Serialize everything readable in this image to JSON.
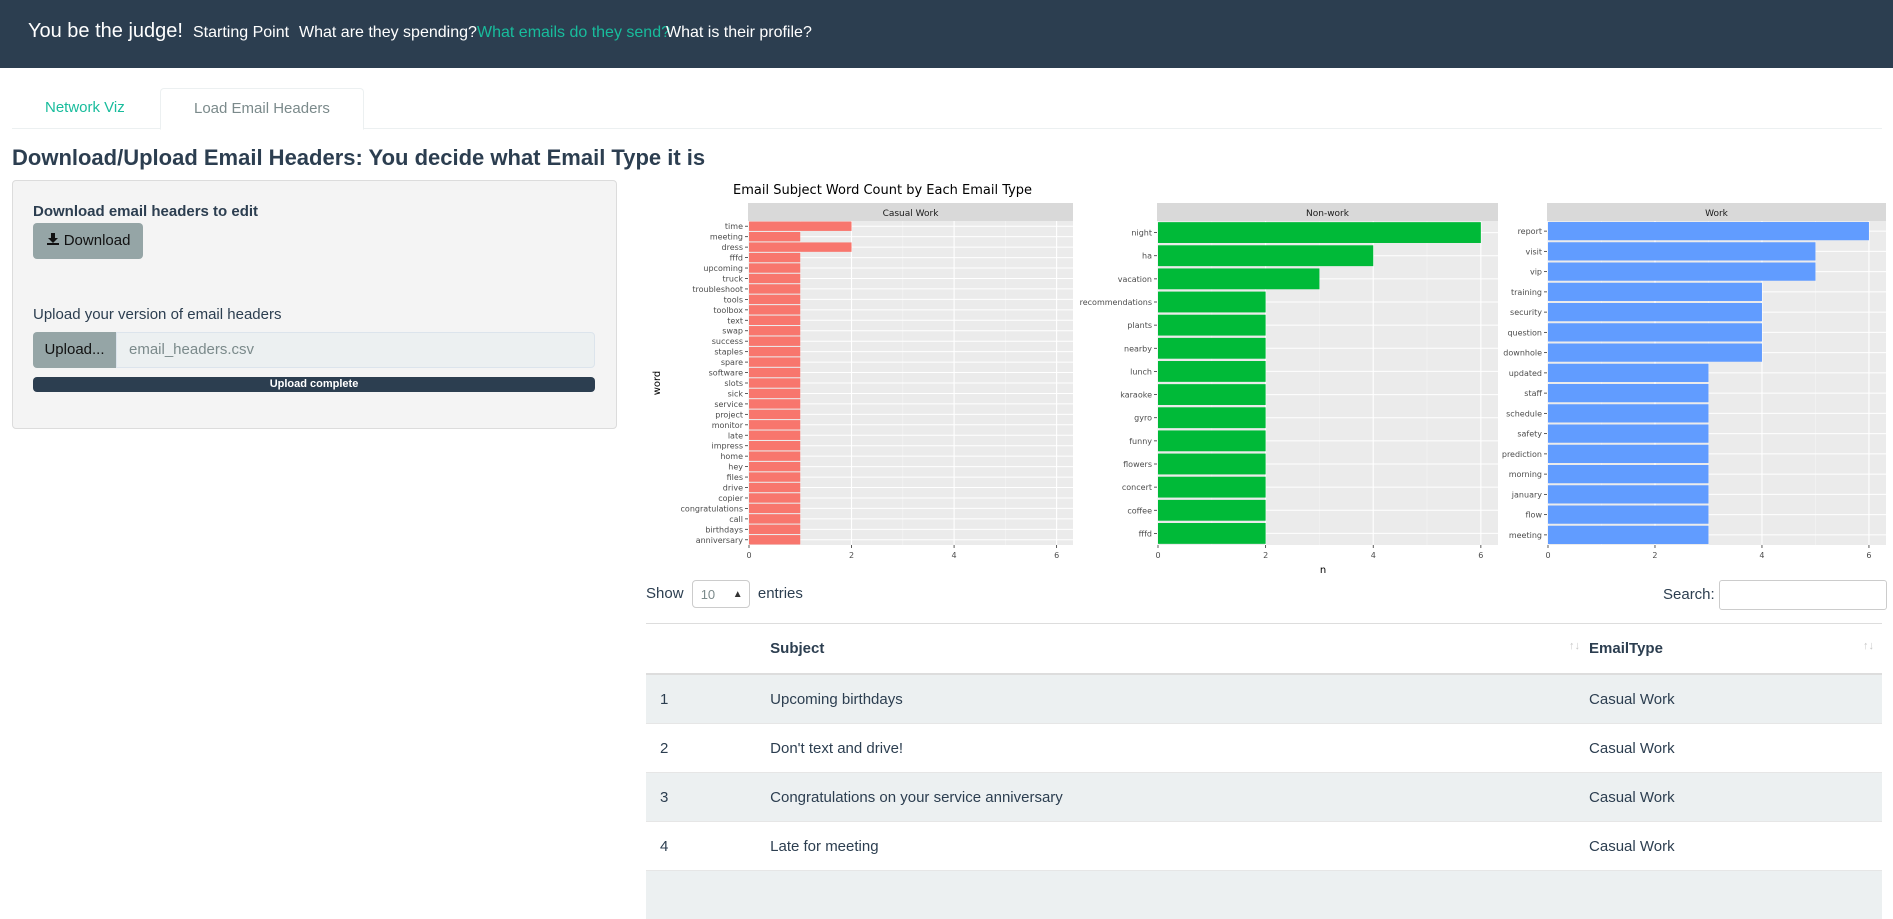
{
  "navbar": {
    "brand": "You be the judge!",
    "links": [
      "Starting Point",
      "What are they spending?",
      "What emails do they send?",
      "What is their profile?"
    ],
    "active_index": 2
  },
  "tabs": [
    "Network Viz",
    "Load Email Headers"
  ],
  "page_title": "Download/Upload Email Headers: You decide what Email Type it is",
  "sidebar": {
    "download_label": "Download email headers to edit",
    "download_button": "Download",
    "upload_label": "Upload your version of email headers",
    "upload_button": "Upload...",
    "file_name": "email_headers.csv",
    "progress_text": "Upload complete",
    "progress_fraction": 1.0
  },
  "chart_data": {
    "type": "bar",
    "orientation": "horizontal",
    "title": "Email Subject Word Count by Each Email Type",
    "xlabel": "n",
    "ylabel": "word",
    "xlim": [
      0,
      6.3
    ],
    "x_ticks": [
      0,
      2,
      4,
      6
    ],
    "facets": [
      {
        "name": "Casual Work",
        "color": "#f8766d",
        "categories": [
          "time",
          "meeting",
          "dress",
          "fffd",
          "upcoming",
          "truck",
          "troubleshoot",
          "tools",
          "toolbox",
          "text",
          "swap",
          "success",
          "staples",
          "spare",
          "software",
          "slots",
          "sick",
          "service",
          "project",
          "monitor",
          "late",
          "impress",
          "home",
          "hey",
          "files",
          "drive",
          "copier",
          "congratulations",
          "call",
          "birthdays",
          "anniversary"
        ],
        "values": [
          2,
          1,
          2,
          1,
          1,
          1,
          1,
          1,
          1,
          1,
          1,
          1,
          1,
          1,
          1,
          1,
          1,
          1,
          1,
          1,
          1,
          1,
          1,
          1,
          1,
          1,
          1,
          1,
          1,
          1,
          1
        ]
      },
      {
        "name": "Non-work",
        "color": "#00ba38",
        "categories": [
          "night",
          "ha",
          "vacation",
          "recommendations",
          "plants",
          "nearby",
          "lunch",
          "karaoke",
          "gyro",
          "funny",
          "flowers",
          "concert",
          "coffee",
          "fffd"
        ],
        "values": [
          6,
          4,
          3,
          2,
          2,
          2,
          2,
          2,
          2,
          2,
          2,
          2,
          2,
          2
        ]
      },
      {
        "name": "Work",
        "color": "#619cff",
        "categories": [
          "report",
          "visit",
          "vip",
          "training",
          "security",
          "question",
          "downhole",
          "updated",
          "staff",
          "schedule",
          "safety",
          "prediction",
          "morning",
          "january",
          "flow",
          "meeting"
        ],
        "values": [
          6,
          5,
          5,
          4,
          4,
          4,
          4,
          3,
          3,
          3,
          3,
          3,
          3,
          3,
          3,
          3
        ]
      }
    ]
  },
  "datatable": {
    "show_label": "Show",
    "length_value": "10",
    "entries_label": "entries",
    "search_label": "Search:",
    "columns": [
      "",
      "Subject",
      "EmailType"
    ],
    "rows": [
      [
        "1",
        "Upcoming birthdays",
        "Casual Work"
      ],
      [
        "2",
        "Don't text and drive!",
        "Casual Work"
      ],
      [
        "3",
        "Congratulations on your service anniversary",
        "Casual Work"
      ],
      [
        "4",
        "Late for meeting",
        "Casual Work"
      ]
    ]
  }
}
